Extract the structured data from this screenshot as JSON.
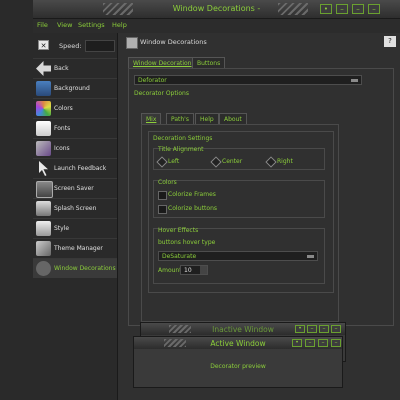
{
  "window": {
    "title": "Window Decorations -",
    "buttons": [
      "•",
      "–",
      "–",
      "–"
    ]
  },
  "menubar": {
    "items": [
      "File",
      "View",
      "Settings",
      "Help"
    ]
  },
  "sidebar": {
    "speed_label": "Speed:",
    "items": [
      {
        "label": "Back",
        "icon": "back-arrow-icon"
      },
      {
        "label": "Background",
        "icon": "background-icon"
      },
      {
        "label": "Colors",
        "icon": "colors-icon"
      },
      {
        "label": "Fonts",
        "icon": "fonts-icon"
      },
      {
        "label": "Icons",
        "icon": "icons-icon"
      },
      {
        "label": "Launch Feedback",
        "icon": "launch-feedback-icon"
      },
      {
        "label": "Screen Saver",
        "icon": "screen-saver-icon"
      },
      {
        "label": "Splash Screen",
        "icon": "splash-screen-icon"
      },
      {
        "label": "Style",
        "icon": "style-icon"
      },
      {
        "label": "Theme Manager",
        "icon": "theme-manager-icon"
      },
      {
        "label": "Window Decorations",
        "icon": "window-decorations-icon"
      }
    ]
  },
  "main": {
    "title": "Window Decorations",
    "help_icon": "?",
    "tabs": [
      "Window Decoration",
      "Buttons"
    ],
    "decoration_select": "Deforator",
    "decorator_options_label": "Decorator Options",
    "inner_tabs": [
      "Mix",
      "Path's",
      "Help",
      "About"
    ],
    "decoration_settings_label": "Decoration Settings",
    "title_alignment_label": "Title Alignment",
    "alignment_options": [
      "Left",
      "Center",
      "Right"
    ],
    "colors_label": "Colors",
    "colorize_frames": "Colorize Frames",
    "colorize_buttons": "Colorize buttons",
    "hover_effects_label": "Hover Effects",
    "hover_type_label": "buttons hover type",
    "hover_type_value": "DeSaturate",
    "amount_label": "Amount",
    "amount_value": "10"
  },
  "preview": {
    "inactive_title": "Inactive Window",
    "active_title": "Active Window",
    "body_text": "Decorator preview"
  }
}
